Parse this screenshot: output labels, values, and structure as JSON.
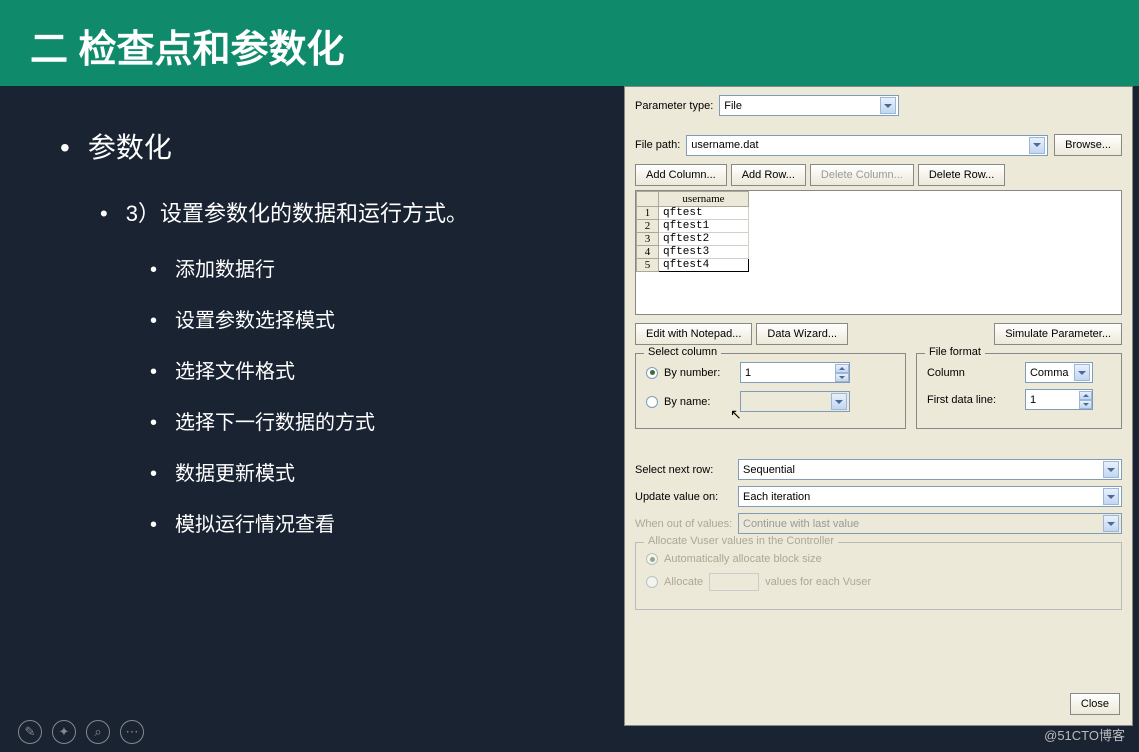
{
  "header": {
    "title": "二  检查点和参数化"
  },
  "bullets": {
    "l1": "参数化",
    "l2": "3）设置参数化的数据和运行方式。",
    "l3": [
      "添加数据行",
      "设置参数选择模式",
      "选择文件格式",
      "选择下一行数据的方式",
      "数据更新模式",
      "模拟运行情况查看"
    ]
  },
  "dialog": {
    "param_type_label": "Parameter type:",
    "param_type_value": "File",
    "file_path_label": "File path:",
    "file_path_value": "username.dat",
    "browse_btn": "Browse...",
    "buttons": {
      "add_col": "Add Column...",
      "add_row": "Add Row...",
      "del_col": "Delete Column...",
      "del_row": "Delete Row..."
    },
    "grid": {
      "header": "username",
      "rows": [
        {
          "n": "1",
          "v": "qftest"
        },
        {
          "n": "2",
          "v": "qftest1"
        },
        {
          "n": "3",
          "v": "qftest2"
        },
        {
          "n": "4",
          "v": "qftest3"
        },
        {
          "n": "5",
          "v": "qftest4"
        }
      ]
    },
    "mid_buttons": {
      "notepad": "Edit with Notepad...",
      "wizard": "Data Wizard...",
      "simulate": "Simulate Parameter..."
    },
    "select_col": {
      "legend": "Select column",
      "by_number": "By number:",
      "by_number_val": "1",
      "by_name": "By name:",
      "by_name_val": ""
    },
    "file_format": {
      "legend": "File format",
      "column_label": "Column",
      "column_val": "Comma",
      "first_line_label": "First data line:",
      "first_line_val": "1"
    },
    "next_row_label": "Select next row:",
    "next_row_val": "Sequential",
    "update_label": "Update value on:",
    "update_val": "Each iteration",
    "when_out_label": "When out of values:",
    "when_out_val": "Continue with last value",
    "alloc": {
      "legend": "Allocate Vuser values in the Controller",
      "auto": "Automatically allocate block size",
      "manual_pre": "Allocate",
      "manual_post": "values for each Vuser"
    },
    "close": "Close"
  },
  "watermark": "@51CTO博客"
}
